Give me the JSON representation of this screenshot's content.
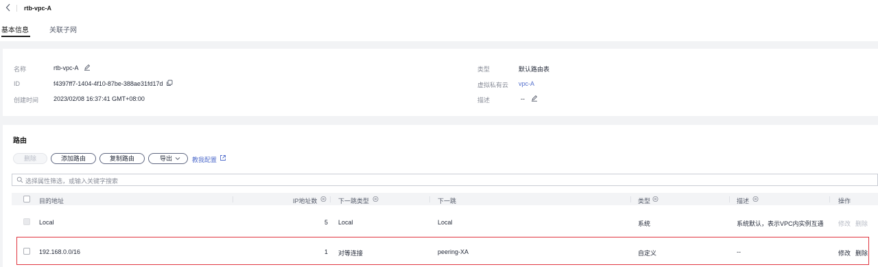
{
  "header": {
    "back_icon": "chevron-left-icon",
    "title": "rtb-vpc-A",
    "tabs": [
      {
        "label": "基本信息",
        "active": true
      },
      {
        "label": "关联子网",
        "active": false
      }
    ]
  },
  "basic_info": {
    "name_label": "名称",
    "name_value": "rtb-vpc-A",
    "id_label": "ID",
    "id_value": "f4397ff7-1404-4f10-87be-388ae31fd17d",
    "created_label": "创建时间",
    "created_value": "2023/02/08 16:37:41 GMT+08:00",
    "type_label": "类型",
    "type_value": "默认路由表",
    "vpc_label": "虚拟私有云",
    "vpc_value": "vpc-A",
    "desc_label": "描述",
    "desc_value": "--"
  },
  "routes": {
    "section_title": "路由",
    "buttons": {
      "delete": "删除",
      "add": "添加路由",
      "copy": "复制路由",
      "export": "导出",
      "guide": "教我配置"
    },
    "search_placeholder": "选择属性筛选，或输入关键字搜索",
    "columns": {
      "destination": "目的地址",
      "ip_count": "IP地址数",
      "next_hop_type": "下一跳类型",
      "next_hop": "下一跳",
      "type": "类型",
      "description": "描述",
      "actions": "操作"
    },
    "rows": [
      {
        "destination": "Local",
        "ip_count": "5",
        "next_hop_type": "Local",
        "next_hop": "Local",
        "type": "系统",
        "description": "系统默认，表示VPC内实例互通",
        "modify": "修改",
        "delete": "删除"
      },
      {
        "destination": "192.168.0.0/16",
        "ip_count": "1",
        "next_hop_type": "对等连接",
        "next_hop": "peering-XA",
        "type": "自定义",
        "description": "--",
        "modify": "修改",
        "delete": "删除"
      }
    ]
  },
  "colors": {
    "link": "#526ecc",
    "highlight_border": "#e0353f",
    "disabled_text": "#b8bcc6"
  }
}
